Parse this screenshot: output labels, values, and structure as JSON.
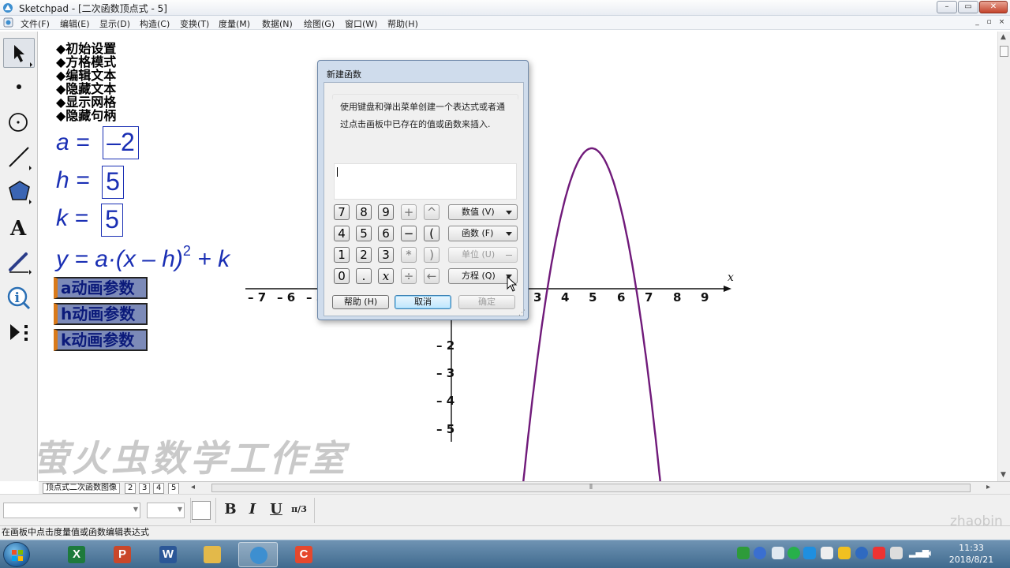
{
  "window": {
    "title": "Sketchpad  - [二次函数顶点式 - 5]",
    "btn_min": "–",
    "btn_max": "▭",
    "btn_close": "✕"
  },
  "menu": [
    "文件(F)",
    "编辑(E)",
    "显示(D)",
    "构造(C)",
    "变换(T)",
    "度量(M)",
    "数据(N)",
    "绘图(G)",
    "窗口(W)",
    "帮助(H)"
  ],
  "doc_buttons": {
    "min": "_",
    "restore": "▫",
    "close": "×"
  },
  "tools": [
    "arrow-select-icon",
    "point-tool-icon",
    "compass-tool-icon",
    "straightedge-tool-icon",
    "polygon-tool-icon",
    "text-tool-icon",
    "marker-tool-icon",
    "information-tool-icon",
    "custom-tool-icon"
  ],
  "canvas": {
    "commands": [
      "◆初始设置",
      "◆方格模式",
      "◆编辑文本",
      "◆隐藏文本",
      "◆显示网格",
      "◆隐藏句柄"
    ],
    "params": [
      {
        "name": "a =",
        "value": "–2"
      },
      {
        "name": "h =",
        "value": "5"
      },
      {
        "name": "k =",
        "value": "5"
      }
    ],
    "formula": {
      "lhs": "y = a·(x – h)",
      "exp": "2",
      "rhs": " + k"
    },
    "anim_buttons": [
      "a动画参数",
      "h动画参数",
      "k动画参数"
    ],
    "x_ticks_neg": [
      "– 7",
      "– 6",
      "– 5"
    ],
    "x_ticks_pos": [
      "3",
      "4",
      "5",
      "6",
      "7",
      "8",
      "9"
    ],
    "y_ticks": [
      "– 2",
      "– 3",
      "– 4",
      "– 5"
    ],
    "x_axis_label": "x",
    "watermark": "萤火虫数学工作室"
  },
  "chart_data": {
    "type": "line",
    "title": "",
    "xlabel": "x",
    "ylabel": "",
    "xlim": [
      -7,
      9
    ],
    "ylim": [
      -5,
      5
    ],
    "series": [
      {
        "function": "y = -2(x - 5)^2 + 5",
        "a": -2,
        "h": 5,
        "k": 5,
        "color": "#701a7a"
      }
    ]
  },
  "dialog": {
    "title": "新建函数",
    "description": "使用键盘和弹出菜单创建一个表达式或者通过点击画板中已存在的值或函数来插入.",
    "expression": "",
    "keys": [
      [
        "7",
        "8",
        "9",
        "+",
        "^"
      ],
      [
        "4",
        "5",
        "6",
        "−",
        "("
      ],
      [
        "1",
        "2",
        "3",
        "*",
        ")"
      ],
      [
        "0",
        ".",
        "x",
        "÷",
        "←"
      ]
    ],
    "dropdowns": [
      {
        "label": "数值 (V)",
        "enabled": true
      },
      {
        "label": "函数 (F)",
        "enabled": true
      },
      {
        "label": "单位 (U)",
        "enabled": false
      },
      {
        "label": "方程 (Q)",
        "enabled": true
      }
    ],
    "help_label": "帮助 (H)",
    "cancel_label": "取消",
    "ok_label": "确定"
  },
  "page_tabs": [
    "顶点式二次函数图像",
    "2",
    "3",
    "4",
    "5"
  ],
  "active_tab": "5",
  "format_bar": {
    "bold": "B",
    "italic": "I",
    "underline": "U",
    "math_label": "π/3"
  },
  "status_text": "在画板中点击度量值或函数编辑表达式",
  "watermark2": "zhaobin",
  "taskbar": {
    "apps": [
      {
        "name": "excel",
        "letter": "X",
        "color": "#1d7a3c"
      },
      {
        "name": "powerpoint",
        "letter": "P",
        "color": "#c9472a"
      },
      {
        "name": "word",
        "letter": "W",
        "color": "#2b5797"
      },
      {
        "name": "explorer",
        "letter": "",
        "color": "#e3b94a"
      },
      {
        "name": "sketchpad",
        "letter": "",
        "color": "#3d8fd0"
      },
      {
        "name": "camtasia",
        "letter": "C",
        "color": "#e5482d"
      }
    ],
    "time": "11:33",
    "date": "2018/8/21"
  },
  "colors": {
    "param_blue": "#1a2fb4",
    "curve_purple": "#701a7a",
    "anim_button_bg": "#7c8ab8"
  }
}
